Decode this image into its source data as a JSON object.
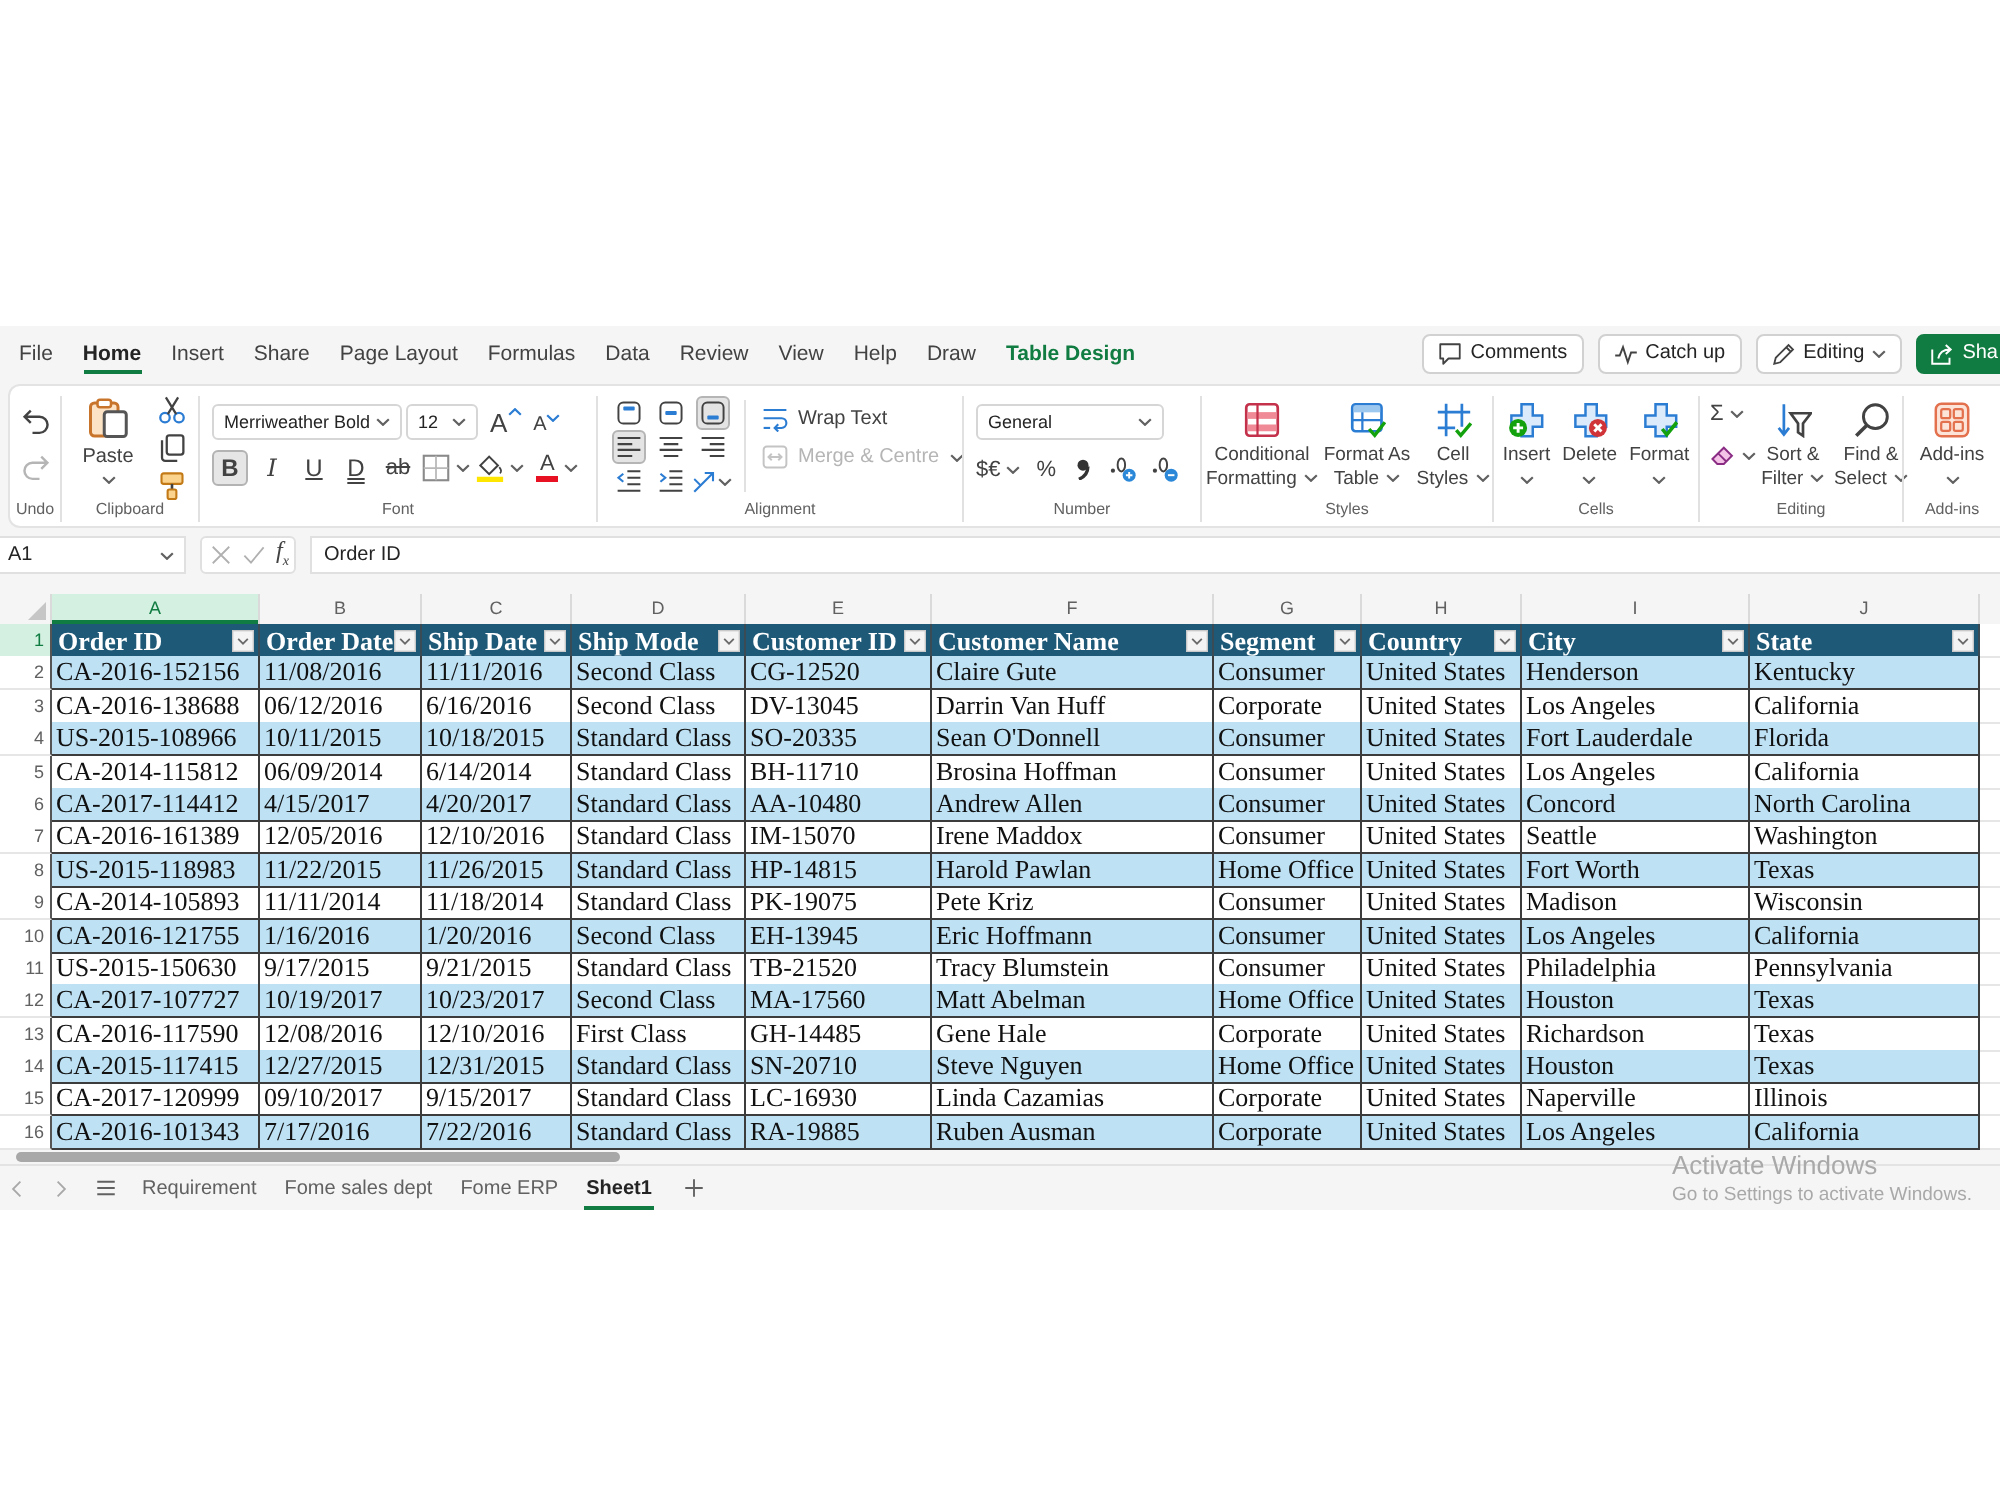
{
  "ribbon_tabs": [
    {
      "label": "File",
      "selected": false,
      "kind": "standard"
    },
    {
      "label": "Home",
      "selected": true,
      "kind": "standard"
    },
    {
      "label": "Insert",
      "selected": false,
      "kind": "standard"
    },
    {
      "label": "Share",
      "selected": false,
      "kind": "standard"
    },
    {
      "label": "Page Layout",
      "selected": false,
      "kind": "standard"
    },
    {
      "label": "Formulas",
      "selected": false,
      "kind": "standard"
    },
    {
      "label": "Data",
      "selected": false,
      "kind": "standard"
    },
    {
      "label": "Review",
      "selected": false,
      "kind": "standard"
    },
    {
      "label": "View",
      "selected": false,
      "kind": "standard"
    },
    {
      "label": "Help",
      "selected": false,
      "kind": "standard"
    },
    {
      "label": "Draw",
      "selected": false,
      "kind": "standard"
    },
    {
      "label": "Table Design",
      "selected": false,
      "kind": "contextual"
    }
  ],
  "header_buttons": [
    {
      "kind": "comments",
      "label": "Comments"
    },
    {
      "kind": "catch_up",
      "label": "Catch up"
    },
    {
      "kind": "editing",
      "label": "Editing"
    },
    {
      "kind": "share",
      "label": "Sha"
    }
  ],
  "ribbon": {
    "groups": [
      {
        "kind": "undo",
        "label": "Undo",
        "buttons": [
          {
            "kind": "undo",
            "disabled": false
          },
          {
            "kind": "redo",
            "disabled": true
          }
        ]
      },
      {
        "kind": "clipboard",
        "label": "Clipboard",
        "paste": "Paste"
      },
      {
        "kind": "font",
        "label": "Font",
        "font_name": "Merriweather Bold",
        "font_size": "12",
        "size_buttons": [
          {
            "kind": "grow",
            "glyph": "A"
          },
          {
            "kind": "shrink",
            "glyph": "A"
          }
        ],
        "format_buttons": [
          {
            "kind": "bold",
            "glyph": "B",
            "selected": true
          },
          {
            "kind": "italic",
            "glyph": "I",
            "selected": false
          },
          {
            "kind": "underline",
            "glyph": "U",
            "selected": false
          },
          {
            "kind": "double_underline",
            "glyph": "D",
            "selected": false
          },
          {
            "kind": "strikethrough",
            "glyph": "ab",
            "selected": false
          }
        ],
        "font_color_glyph": "A"
      },
      {
        "kind": "alignment",
        "label": "Alignment",
        "vertical": [
          {
            "kind": "top",
            "selected": false
          },
          {
            "kind": "middle",
            "selected": false
          },
          {
            "kind": "bottom",
            "selected": true
          }
        ],
        "horizontal": [
          {
            "kind": "left",
            "selected": true
          },
          {
            "kind": "center",
            "selected": false
          },
          {
            "kind": "right",
            "selected": false
          }
        ],
        "wrap_text": "Wrap Text",
        "merge": {
          "label": "Merge & Centre",
          "disabled": true
        }
      },
      {
        "kind": "number",
        "label": "Number",
        "format": "General",
        "currency": "$€",
        "percent": "%"
      },
      {
        "kind": "styles",
        "label": "Styles",
        "buttons": [
          {
            "kind": "conditional_formatting",
            "label": "Conditional Formatting"
          },
          {
            "kind": "format_as_table",
            "label": "Format As Table"
          },
          {
            "kind": "cell_styles",
            "label": "Cell Styles"
          }
        ]
      },
      {
        "kind": "cells",
        "label": "Cells",
        "buttons": [
          {
            "kind": "insert",
            "label": "Insert"
          },
          {
            "kind": "delete",
            "label": "Delete"
          },
          {
            "kind": "format",
            "label": "Format"
          }
        ]
      },
      {
        "kind": "editing",
        "label": "Editing",
        "autosum": "Σ",
        "buttons": [
          {
            "kind": "sort_filter",
            "label": "Sort & Filter"
          },
          {
            "kind": "find_select",
            "label": "Find & Select"
          }
        ]
      },
      {
        "kind": "addins",
        "label": "Add-ins",
        "button": "Add-ins"
      }
    ]
  },
  "formula_bar": {
    "name_box": "A1",
    "function_glyph": "f$_{x}$",
    "formula": "Order ID"
  },
  "sheet": {
    "columns": [
      {
        "letter": "A",
        "selected": true
      },
      {
        "letter": "B",
        "selected": false
      },
      {
        "letter": "C",
        "selected": false
      },
      {
        "letter": "D",
        "selected": false
      },
      {
        "letter": "E",
        "selected": false
      },
      {
        "letter": "F",
        "selected": false
      },
      {
        "letter": "G",
        "selected": false
      },
      {
        "letter": "H",
        "selected": false
      },
      {
        "letter": "I",
        "selected": false
      },
      {
        "letter": "J",
        "selected": false
      }
    ],
    "header_row": {
      "number": "1",
      "selected": true,
      "cells": [
        "Order ID",
        "Order Date",
        "Ship Date",
        "Ship Mode",
        "Customer ID",
        "Customer Name",
        "Segment",
        "Country",
        "City",
        "State"
      ]
    },
    "rows": [
      {
        "number": "2",
        "selected": false,
        "cells": [
          "CA-2016-152156",
          "11/08/2016",
          "11/11/2016",
          "Second Class",
          "CG-12520",
          "Claire Gute",
          "Consumer",
          "United States",
          "Henderson",
          "Kentucky"
        ]
      },
      {
        "number": "3",
        "selected": false,
        "cells": [
          "CA-2016-138688",
          "06/12/2016",
          "6/16/2016",
          "Second Class",
          "DV-13045",
          "Darrin Van Huff",
          "Corporate",
          "United States",
          "Los Angeles",
          "California"
        ]
      },
      {
        "number": "4",
        "selected": false,
        "cells": [
          "US-2015-108966",
          "10/11/2015",
          "10/18/2015",
          "Standard Class",
          "SO-20335",
          "Sean O'Donnell",
          "Consumer",
          "United States",
          "Fort Lauderdale",
          "Florida"
        ]
      },
      {
        "number": "5",
        "selected": false,
        "cells": [
          "CA-2014-115812",
          "06/09/2014",
          "6/14/2014",
          "Standard Class",
          "BH-11710",
          "Brosina Hoffman",
          "Consumer",
          "United States",
          "Los Angeles",
          "California"
        ]
      },
      {
        "number": "6",
        "selected": false,
        "cells": [
          "CA-2017-114412",
          "4/15/2017",
          "4/20/2017",
          "Standard Class",
          "AA-10480",
          "Andrew Allen",
          "Consumer",
          "United States",
          "Concord",
          "North Carolina"
        ]
      },
      {
        "number": "7",
        "selected": false,
        "cells": [
          "CA-2016-161389",
          "12/05/2016",
          "12/10/2016",
          "Standard Class",
          "IM-15070",
          "Irene Maddox",
          "Consumer",
          "United States",
          "Seattle",
          "Washington"
        ]
      },
      {
        "number": "8",
        "selected": false,
        "cells": [
          "US-2015-118983",
          "11/22/2015",
          "11/26/2015",
          "Standard Class",
          "HP-14815",
          "Harold Pawlan",
          "Home Office",
          "United States",
          "Fort Worth",
          "Texas"
        ]
      },
      {
        "number": "9",
        "selected": false,
        "cells": [
          "CA-2014-105893",
          "11/11/2014",
          "11/18/2014",
          "Standard Class",
          "PK-19075",
          "Pete Kriz",
          "Consumer",
          "United States",
          "Madison",
          "Wisconsin"
        ]
      },
      {
        "number": "10",
        "selected": false,
        "cells": [
          "CA-2016-121755",
          "1/16/2016",
          "1/20/2016",
          "Second Class",
          "EH-13945",
          "Eric Hoffmann",
          "Consumer",
          "United States",
          "Los Angeles",
          "California"
        ]
      },
      {
        "number": "11",
        "selected": false,
        "cells": [
          "US-2015-150630",
          "9/17/2015",
          "9/21/2015",
          "Standard Class",
          "TB-21520",
          "Tracy Blumstein",
          "Consumer",
          "United States",
          "Philadelphia",
          "Pennsylvania"
        ]
      },
      {
        "number": "12",
        "selected": false,
        "cells": [
          "CA-2017-107727",
          "10/19/2017",
          "10/23/2017",
          "Second Class",
          "MA-17560",
          "Matt Abelman",
          "Home Office",
          "United States",
          "Houston",
          "Texas"
        ]
      },
      {
        "number": "13",
        "selected": false,
        "cells": [
          "CA-2016-117590",
          "12/08/2016",
          "12/10/2016",
          "First Class",
          "GH-14485",
          "Gene Hale",
          "Corporate",
          "United States",
          "Richardson",
          "Texas"
        ]
      },
      {
        "number": "14",
        "selected": false,
        "cells": [
          "CA-2015-117415",
          "12/27/2015",
          "12/31/2015",
          "Standard Class",
          "SN-20710",
          "Steve Nguyen",
          "Home Office",
          "United States",
          "Houston",
          "Texas"
        ]
      },
      {
        "number": "15",
        "selected": false,
        "cells": [
          "CA-2017-120999",
          "09/10/2017",
          "9/15/2017",
          "Standard Class",
          "LC-16930",
          "Linda Cazamias",
          "Corporate",
          "United States",
          "Naperville",
          "Illinois"
        ]
      },
      {
        "number": "16",
        "selected": false,
        "cells": [
          "CA-2016-101343",
          "7/17/2016",
          "7/22/2016",
          "Standard Class",
          "RA-19885",
          "Ruben Ausman",
          "Corporate",
          "United States",
          "Los Angeles",
          "California"
        ]
      }
    ]
  },
  "sheet_tabs": [
    {
      "label": "Requirement",
      "selected": false
    },
    {
      "label": "Fome sales dept",
      "selected": false
    },
    {
      "label": "Fome ERP",
      "selected": false
    },
    {
      "label": "Sheet1",
      "selected": true
    }
  ],
  "activation_notice": {
    "title": "Activate Windows",
    "message": "Go to Settings to activate Windows."
  }
}
